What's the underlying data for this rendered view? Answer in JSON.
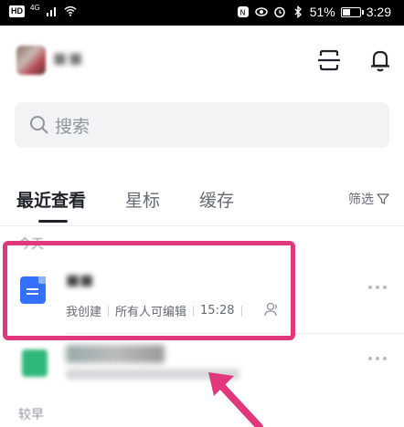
{
  "status_bar": {
    "hd": "HD",
    "network": "4G",
    "battery_percent": "51%",
    "battery_level": 0.51,
    "time": "3:29"
  },
  "header": {
    "icons": [
      "scan-icon",
      "bell-icon"
    ]
  },
  "search": {
    "placeholder": "搜索"
  },
  "tabs": [
    {
      "label": "最近查看",
      "active": true
    },
    {
      "label": "星标",
      "active": false
    },
    {
      "label": "缓存",
      "active": false
    }
  ],
  "filter_label": "筛选",
  "sections": {
    "today": "今天",
    "earlier": "较早"
  },
  "items": [
    {
      "type": "doc",
      "meta": [
        "我创建",
        "所有人可编辑",
        "15:28"
      ]
    },
    {
      "type": "sheet"
    }
  ],
  "colors": {
    "accent_blue": "#3370ff",
    "highlight": "#e0377d",
    "sheet_green": "#2fb77a"
  }
}
